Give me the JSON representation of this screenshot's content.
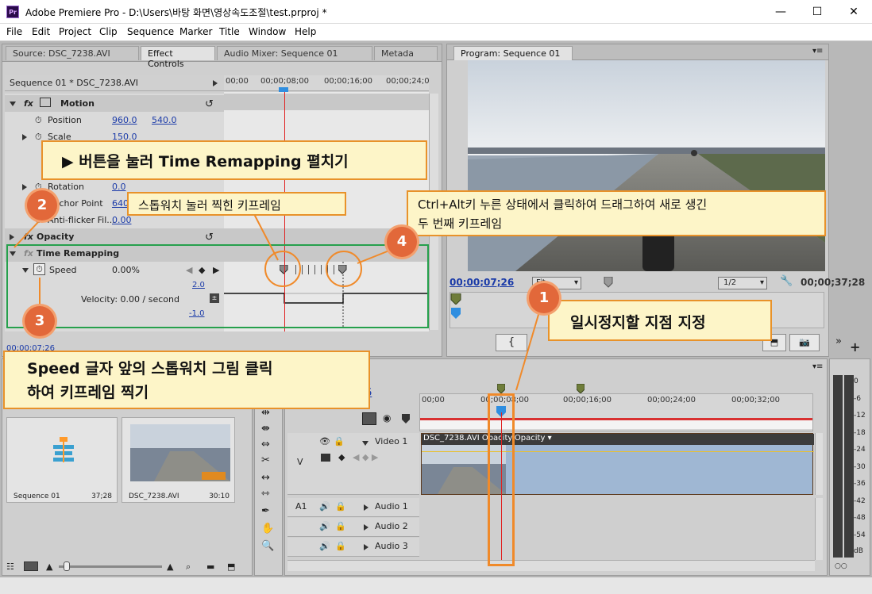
{
  "window": {
    "title": "Adobe Premiere Pro - D:\\Users\\바탕 화면\\영상속도조절\\test.prproj *",
    "icon": "Pr"
  },
  "menu": [
    "File",
    "Edit",
    "Project",
    "Clip",
    "Sequence",
    "Marker",
    "Title",
    "Window",
    "Help"
  ],
  "source_tabs": [
    "Source: DSC_7238.AVI",
    "Effect Controls",
    "Audio Mixer: Sequence 01",
    "Metada"
  ],
  "program_tab": "Program: Sequence 01",
  "effect_controls": {
    "clip_label": "Sequence 01 * DSC_7238.AVI",
    "ruler": [
      "00;00",
      "00;00;08;00",
      "00;00;16;00",
      "00;00;24;0"
    ],
    "motion": "Motion",
    "position_label": "Position",
    "position_x": "960.0",
    "position_y": "540.0",
    "scale_label": "Scale",
    "scale_value": "150.0",
    "rotation_label": "Rotation",
    "rotation_value": "0.0",
    "anchor_label": "Anchor Point",
    "anchor_value": "640",
    "antiflicker_label": "Anti-flicker Fil...",
    "antiflicker_value": "0.00",
    "opacity": "Opacity",
    "time_remap": "Time Remapping",
    "speed_label": "Speed",
    "speed_value": "0.00%",
    "graph_top": "2.0",
    "graph_bottom": "-1.0",
    "velocity": "Velocity: 0.00 / second",
    "timecode": "00;00;07;26"
  },
  "program": {
    "timecode_left": "00;00;07;26",
    "timecode_right": "00;00;37;28",
    "zoom": "Fit",
    "resolution": "1/2"
  },
  "project": {
    "items": [
      {
        "name": "Sequence 01",
        "duration": "37;28"
      },
      {
        "name": "DSC_7238.AVI",
        "duration": "30:10"
      }
    ]
  },
  "timeline": {
    "timecode_partial": "6",
    "ruler": [
      "00;00",
      "00;00;08;00",
      "00;00;16;00",
      "00;00;24;00",
      "00;00;32;00"
    ],
    "video1": "Video 1",
    "clip_label": "DSC_7238.AVI  Opacity:Opacity ▾",
    "v_label": "V",
    "a1_label": "A1",
    "audio1": "Audio 1",
    "audio2": "Audio 2",
    "audio3": "Audio 3"
  },
  "meter": [
    "0",
    "-6",
    "-12",
    "-18",
    "-24",
    "-30",
    "-36",
    "-42",
    "-48",
    "-54",
    "dB"
  ],
  "callouts": {
    "c1": "일시정지할 지점 지정",
    "c2": "▶ 버튼을 눌러 Time Remapping 펼치기",
    "c3": "Speed 글자 앞의 스톱워치 그림 클릭\n하여 키프레임 찍기",
    "c4": "Ctrl+Alt키 누른 상태에서 클릭하여 드래그하여 새로 생긴\n두 번째 키프레임",
    "stopwatch_kf": "스톱워치 눌러 찍힌 키프레임",
    "b1": "1",
    "b2": "2",
    "b3": "3",
    "b4": "4"
  }
}
